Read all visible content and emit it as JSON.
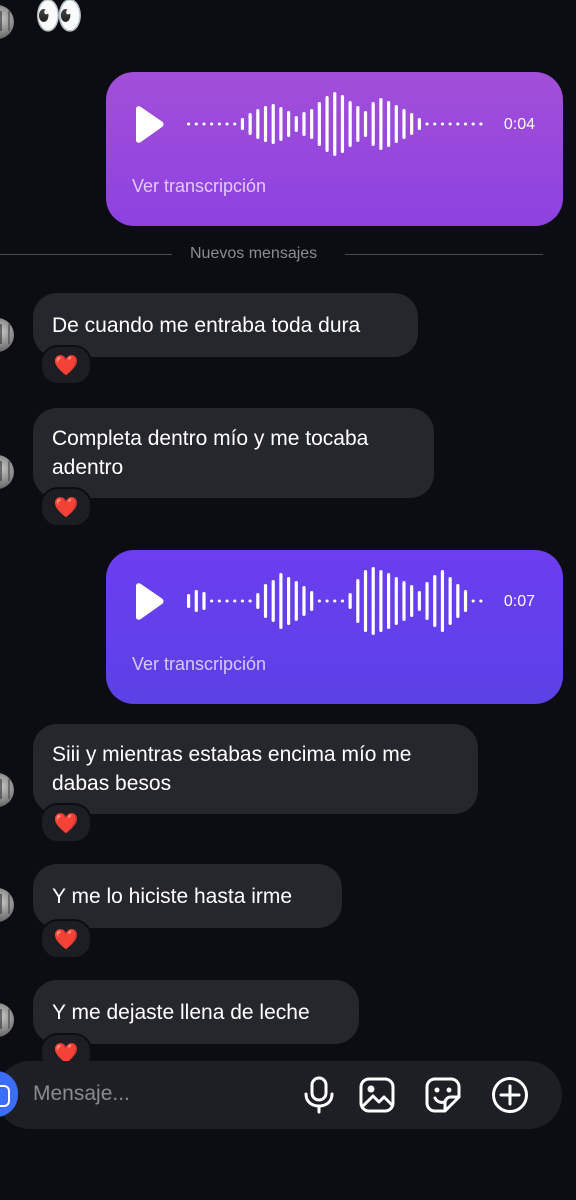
{
  "top": {
    "emoji": "👀"
  },
  "voice_messages": [
    {
      "duration": "0:04",
      "transcript_label": "Ver transcripción",
      "color_from": "#a24ed8",
      "color_to": "#8a3fe0"
    },
    {
      "duration": "0:07",
      "transcript_label": "Ver transcripción",
      "color_from": "#6a3df0",
      "color_to": "#5a40e8"
    }
  ],
  "divider": {
    "label": "Nuevos mensajes"
  },
  "messages": [
    {
      "text": "De cuando me entraba toda dura",
      "reaction": "❤️"
    },
    {
      "text": "Completa dentro mío y me tocaba adentro",
      "reaction": "❤️"
    },
    {
      "text": "Siii y mientras estabas encima mío me dabas besos",
      "reaction": "❤️"
    },
    {
      "text": "Y me lo hiciste hasta irme",
      "reaction": "❤️"
    },
    {
      "text": "Y me dejaste llena de leche",
      "reaction": "❤️"
    }
  ],
  "composer": {
    "placeholder": "Mensaje..."
  },
  "icons": [
    "eyes-emoji",
    "play-icon",
    "waveform",
    "camera-icon",
    "microphone-icon",
    "image-icon",
    "sticker-icon",
    "plus-circle-icon"
  ]
}
